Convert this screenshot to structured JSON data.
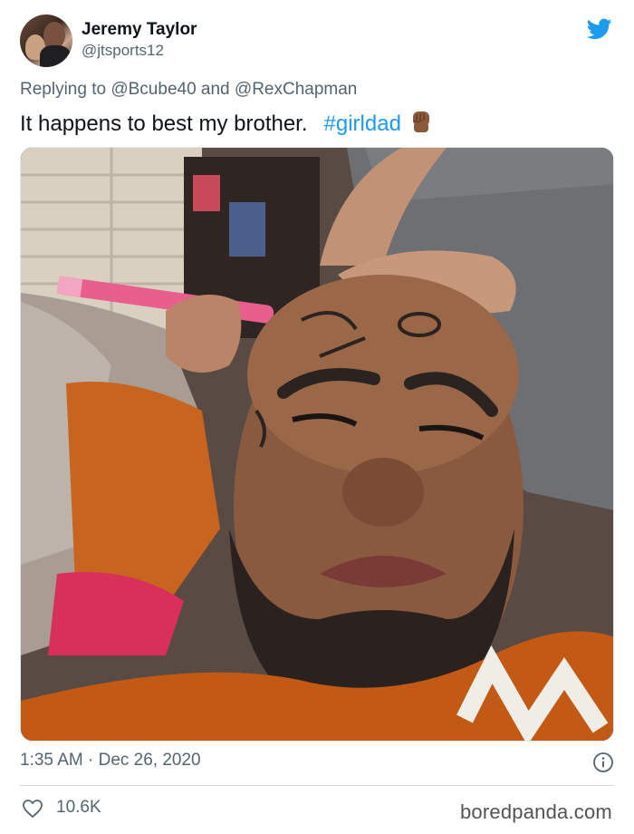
{
  "author": {
    "name": "Jeremy Taylor",
    "handle": "@jtsports12",
    "avatar_icon": "profile-photo"
  },
  "platform_icon": "twitter-bird-icon",
  "brand_color": "#1d9bf0",
  "reply": {
    "prefix": "Replying to",
    "mention1": "@Bcube40",
    "joiner": "and",
    "mention2": "@RexChapman"
  },
  "tweet": {
    "text": "It happens to best my brother.",
    "hashtag": "#girldad",
    "emoji": "raised-fist-dark-skin-tone"
  },
  "media": {
    "type": "photo"
  },
  "meta": {
    "time": "1:35 AM · Dec 26, 2020",
    "info_icon": "info-icon"
  },
  "engagement": {
    "likes": "10.6K",
    "like_icon": "heart-icon"
  },
  "watermark": "boredpanda.com"
}
